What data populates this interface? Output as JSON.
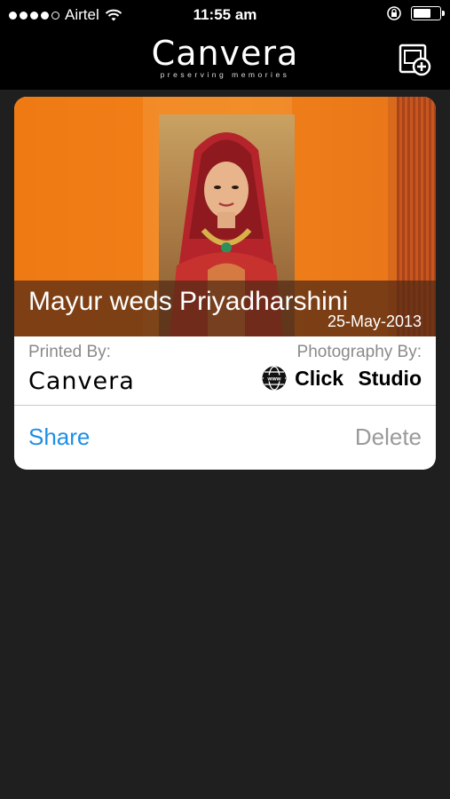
{
  "status_bar": {
    "carrier": "Airtel",
    "time": "11:55 am"
  },
  "header": {
    "logo_text": "Canvera",
    "logo_tagline": "preserving memories"
  },
  "album": {
    "title": "Mayur weds Priyadharshini",
    "date": "25-May-2013",
    "printed_by_label": "Printed By:",
    "printed_by": "Canvera",
    "photography_by_label": "Photography By:",
    "studio": "Click Studio"
  },
  "actions": {
    "share_label": "Share",
    "delete_label": "Delete"
  },
  "colors": {
    "accent": "#1e8fe4",
    "cover_orange": "#ef7a14"
  }
}
